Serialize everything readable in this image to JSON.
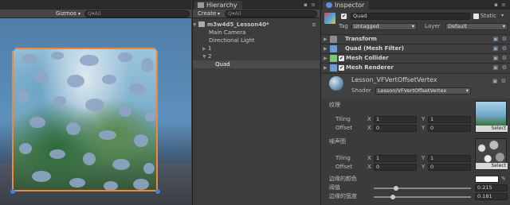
{
  "scene": {
    "toolbar_gizmos": "Gizmos",
    "search_placeholder": "Q▾All"
  },
  "hierarchy": {
    "tab_label": "Hierarchy",
    "create_label": "Create",
    "search_placeholder": "Q▾All",
    "rows": [
      {
        "label": "m3w4d5_Lesson40*"
      },
      {
        "label": "Main Camera"
      },
      {
        "label": "Directional Light"
      },
      {
        "label": "1"
      },
      {
        "label": "2"
      },
      {
        "label": "Quad"
      }
    ]
  },
  "inspector": {
    "tab_label": "Inspector",
    "object_name": "Quad",
    "static_label": "Static",
    "tag_label": "Tag",
    "tag_value": "Untagged",
    "layer_label": "Layer",
    "layer_value": "Default",
    "components": [
      {
        "label": "Transform"
      },
      {
        "label": "Quad (Mesh Filter)"
      },
      {
        "label": "Mesh Collider"
      },
      {
        "label": "Mesh Renderer"
      }
    ],
    "material_name": "Lesson_VFVertOffsetVertex",
    "shader_label": "Shader",
    "shader_value": "Lesson/VFVertOffsetVertex",
    "tex1": {
      "label": "纹理",
      "tiling": "Tiling",
      "offset": "Offset",
      "tx": "1",
      "ty": "1",
      "ox": "0",
      "oy": "0",
      "select": "Select"
    },
    "tex2": {
      "label": "噪声图",
      "tiling": "Tiling",
      "offset": "Offset",
      "tx": "1",
      "ty": "1",
      "ox": "0",
      "oy": "0",
      "select": "Select"
    },
    "edge_color_label": "边缘的颜色",
    "threshold_label": "阈值",
    "threshold_value": "0.215",
    "edge_width_label": "边缘的宽度",
    "edge_width_value": "0.181",
    "x": "X",
    "y": "Y"
  }
}
